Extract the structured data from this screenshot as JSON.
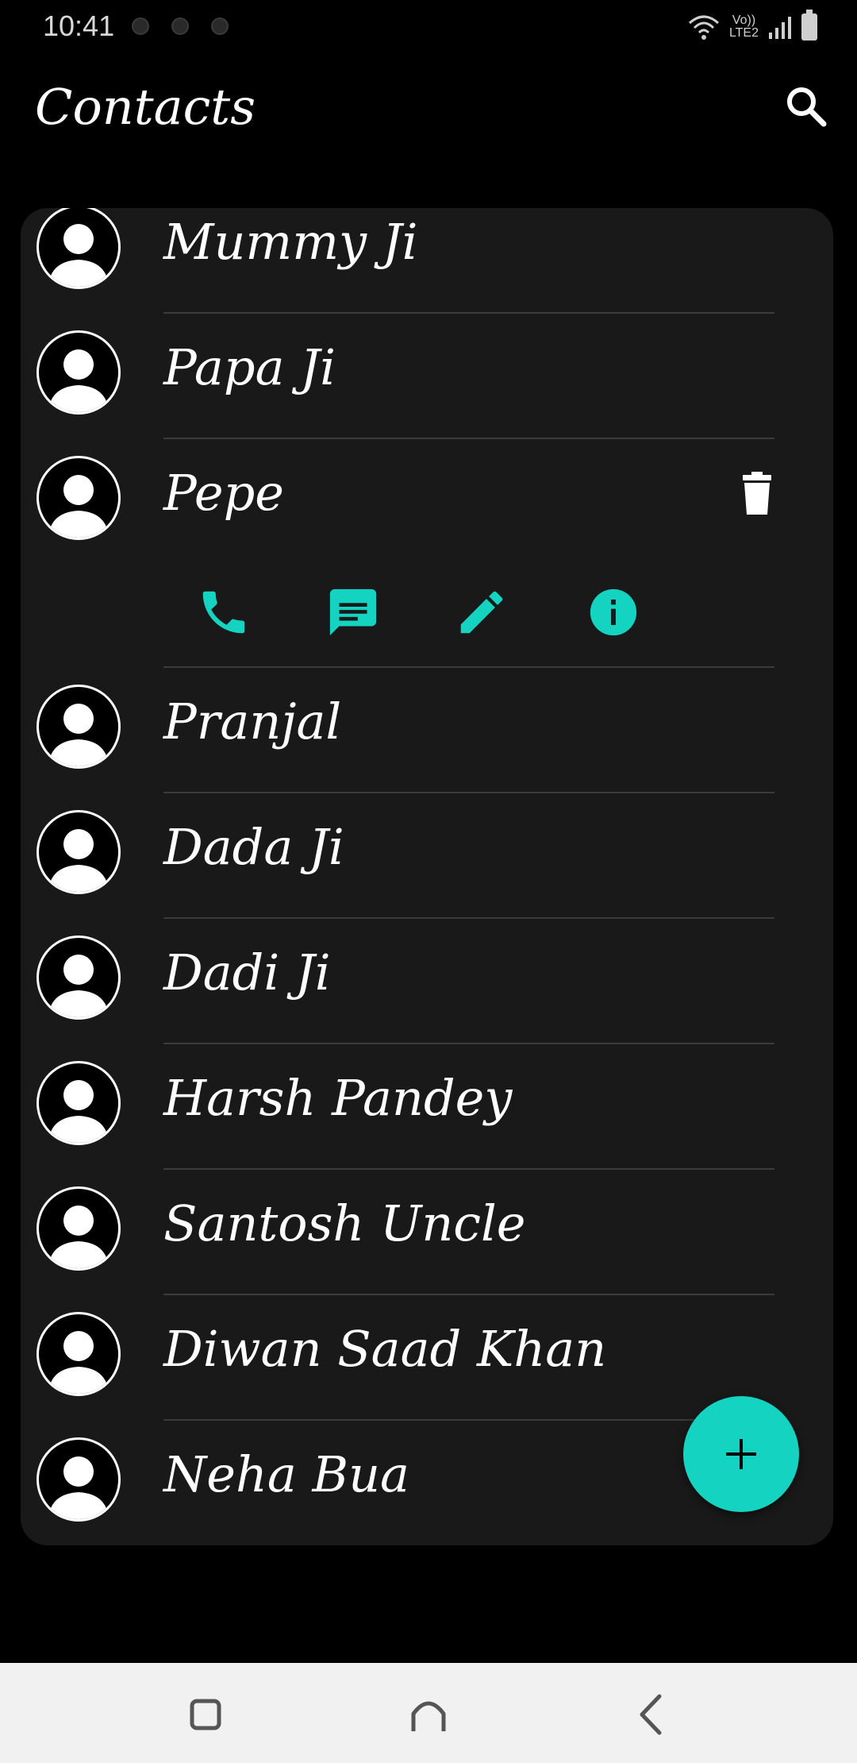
{
  "status_bar": {
    "time": "10:41",
    "network_label_top": "Vo))",
    "network_label_bottom": "LTE2",
    "icons": [
      "wifi-icon",
      "signal-icon",
      "battery-icon"
    ]
  },
  "app_bar": {
    "title": "Contacts",
    "search_icon": "search-icon"
  },
  "contacts": [
    {
      "name": "Mummy Ji"
    },
    {
      "name": "Papa Ji"
    },
    {
      "name": "Pepe",
      "expanded": true
    },
    {
      "name": "Pranjal"
    },
    {
      "name": "Dada Ji"
    },
    {
      "name": "Dadi Ji"
    },
    {
      "name": "Harsh Pandey"
    },
    {
      "name": "Santosh Uncle"
    },
    {
      "name": "Diwan Saad Khan"
    },
    {
      "name": "Neha Bua"
    }
  ],
  "expanded_actions": [
    "phone-icon",
    "message-icon",
    "edit-icon",
    "info-icon"
  ],
  "delete_icon": "trash-icon",
  "fab_icon": "plus-icon",
  "nav_bar": [
    "recents-icon",
    "home-icon",
    "back-icon"
  ],
  "colors": {
    "background": "#000000",
    "card": "#191919",
    "accent": "#14d3c0",
    "divider": "#3b3b3b",
    "nav_bar": "#f1f1f1"
  }
}
